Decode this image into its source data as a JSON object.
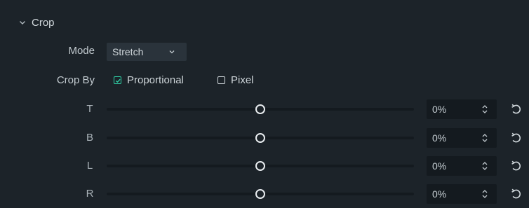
{
  "section": {
    "title": "Crop",
    "expanded": true
  },
  "mode": {
    "label": "Mode",
    "value": "Stretch"
  },
  "crop_by": {
    "label": "Crop By",
    "options": [
      {
        "label": "Proportional",
        "checked": true
      },
      {
        "label": "Pixel",
        "checked": false
      }
    ]
  },
  "sliders": [
    {
      "label": "T",
      "value": "0%",
      "level": 0.5
    },
    {
      "label": "B",
      "value": "0%",
      "level": 0.5
    },
    {
      "label": "L",
      "value": "0%",
      "level": 0.5
    },
    {
      "label": "R",
      "value": "0%",
      "level": 0.5
    }
  ],
  "colors": {
    "background": "#1c2329",
    "accent": "#2fd3a8",
    "track": "#141a1f",
    "text": "#c9d1d6"
  },
  "icons": {
    "section_toggle": "chevron-down-icon",
    "mode_dropdown": "chevron-down-icon",
    "stepper": "up-down-stepper-icon",
    "reset": "reset-icon"
  }
}
